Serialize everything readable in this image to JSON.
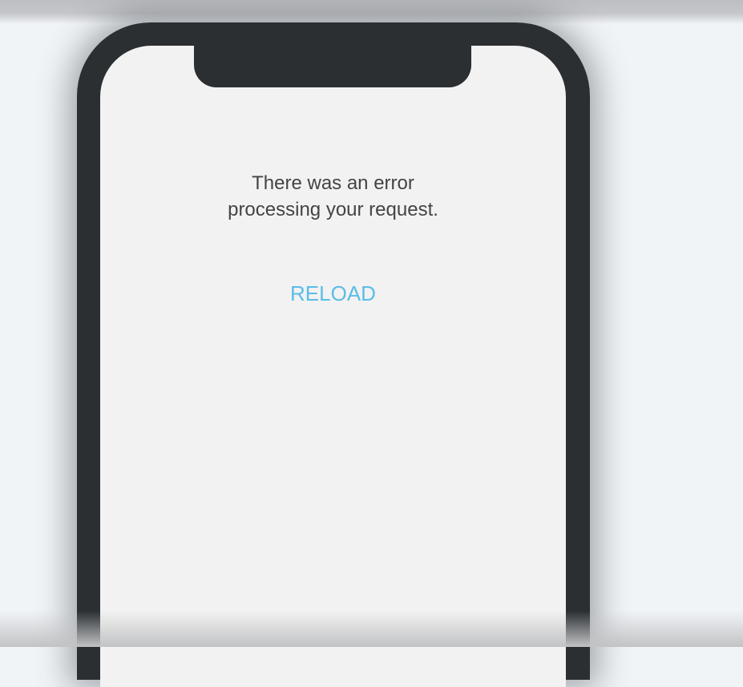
{
  "error": {
    "line1": "There was an error",
    "line2": "processing your request."
  },
  "reload_label": "RELOAD",
  "colors": {
    "accent": "#5bbde8",
    "frame": "#2b2f32",
    "screen": "#f2f2f2"
  }
}
